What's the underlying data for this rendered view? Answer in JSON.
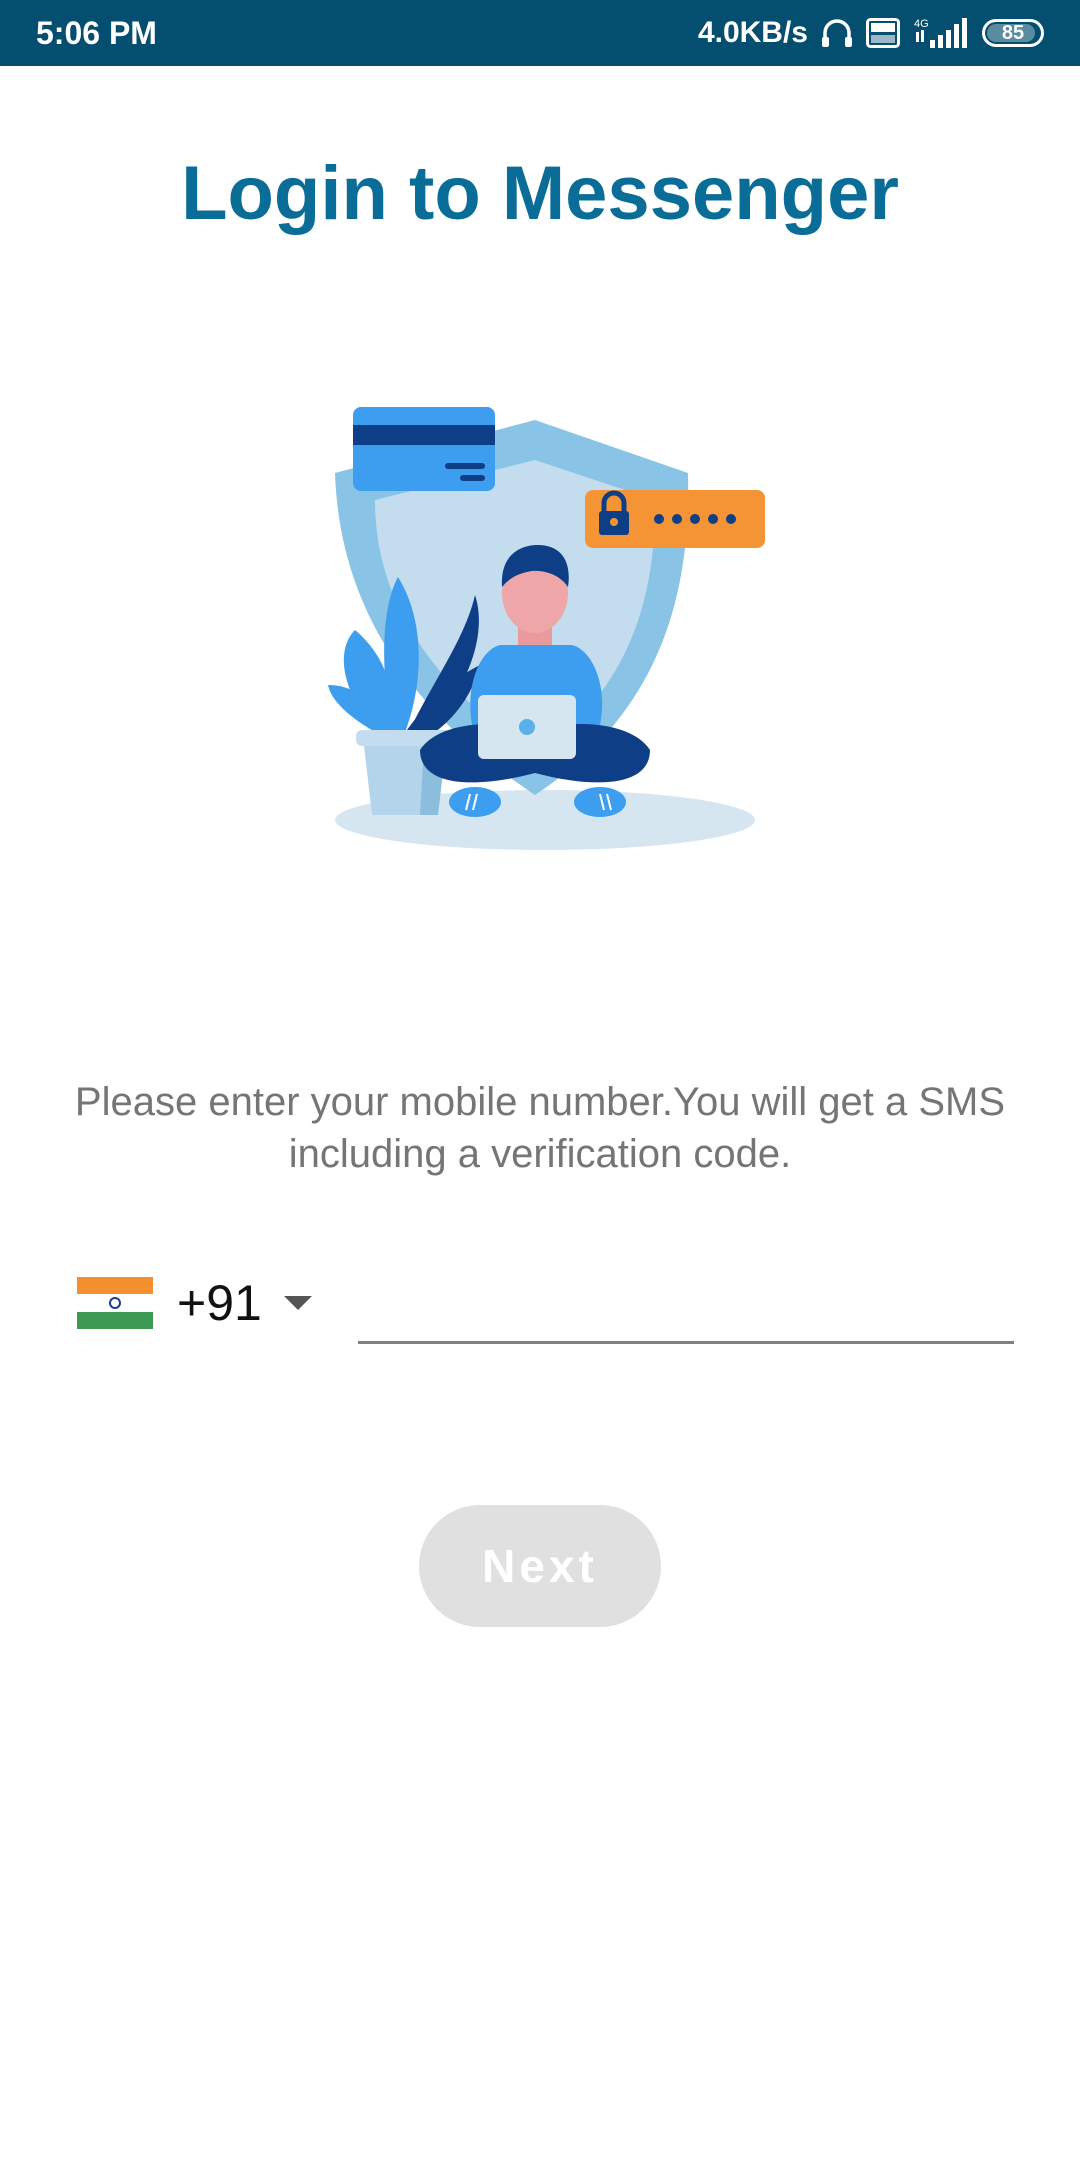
{
  "status_bar": {
    "time": "5:06 PM",
    "net_speed": "4.0KB/s",
    "network": "4G",
    "volte": "Vo LTE",
    "battery": "85",
    "battery_level": 0.85,
    "icons": [
      "headphones-icon",
      "volte-icon",
      "signal-icon",
      "battery-icon"
    ]
  },
  "header": {
    "title": "Login to Messenger"
  },
  "illustration": {
    "icon": "security-login-illustration"
  },
  "instruction": {
    "text": "Please enter your mobile number.You will get a SMS including a verification code."
  },
  "phone": {
    "country_flag": "india-flag-icon",
    "country_code": "+91",
    "number_value": "",
    "number_placeholder": ""
  },
  "actions": {
    "next_label": "Next"
  },
  "colors": {
    "status_bar": "#044e6f",
    "title": "#0a6d97",
    "instruction_text": "#757575",
    "button_disabled": "#e0e0e0"
  }
}
